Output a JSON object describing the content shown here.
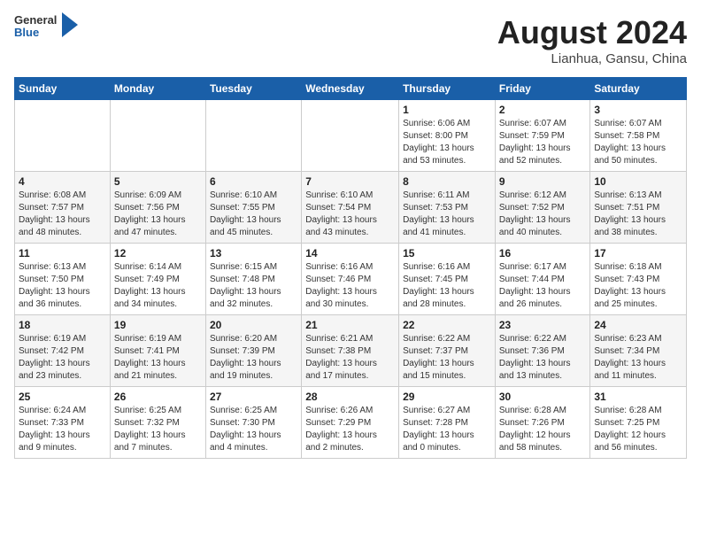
{
  "header": {
    "logo_general": "General",
    "logo_blue": "Blue",
    "month_title": "August 2024",
    "location": "Lianhua, Gansu, China"
  },
  "weekdays": [
    "Sunday",
    "Monday",
    "Tuesday",
    "Wednesday",
    "Thursday",
    "Friday",
    "Saturday"
  ],
  "weeks": [
    [
      {
        "day": "",
        "info": ""
      },
      {
        "day": "",
        "info": ""
      },
      {
        "day": "",
        "info": ""
      },
      {
        "day": "",
        "info": ""
      },
      {
        "day": "1",
        "info": "Sunrise: 6:06 AM\nSunset: 8:00 PM\nDaylight: 13 hours\nand 53 minutes."
      },
      {
        "day": "2",
        "info": "Sunrise: 6:07 AM\nSunset: 7:59 PM\nDaylight: 13 hours\nand 52 minutes."
      },
      {
        "day": "3",
        "info": "Sunrise: 6:07 AM\nSunset: 7:58 PM\nDaylight: 13 hours\nand 50 minutes."
      }
    ],
    [
      {
        "day": "4",
        "info": "Sunrise: 6:08 AM\nSunset: 7:57 PM\nDaylight: 13 hours\nand 48 minutes."
      },
      {
        "day": "5",
        "info": "Sunrise: 6:09 AM\nSunset: 7:56 PM\nDaylight: 13 hours\nand 47 minutes."
      },
      {
        "day": "6",
        "info": "Sunrise: 6:10 AM\nSunset: 7:55 PM\nDaylight: 13 hours\nand 45 minutes."
      },
      {
        "day": "7",
        "info": "Sunrise: 6:10 AM\nSunset: 7:54 PM\nDaylight: 13 hours\nand 43 minutes."
      },
      {
        "day": "8",
        "info": "Sunrise: 6:11 AM\nSunset: 7:53 PM\nDaylight: 13 hours\nand 41 minutes."
      },
      {
        "day": "9",
        "info": "Sunrise: 6:12 AM\nSunset: 7:52 PM\nDaylight: 13 hours\nand 40 minutes."
      },
      {
        "day": "10",
        "info": "Sunrise: 6:13 AM\nSunset: 7:51 PM\nDaylight: 13 hours\nand 38 minutes."
      }
    ],
    [
      {
        "day": "11",
        "info": "Sunrise: 6:13 AM\nSunset: 7:50 PM\nDaylight: 13 hours\nand 36 minutes."
      },
      {
        "day": "12",
        "info": "Sunrise: 6:14 AM\nSunset: 7:49 PM\nDaylight: 13 hours\nand 34 minutes."
      },
      {
        "day": "13",
        "info": "Sunrise: 6:15 AM\nSunset: 7:48 PM\nDaylight: 13 hours\nand 32 minutes."
      },
      {
        "day": "14",
        "info": "Sunrise: 6:16 AM\nSunset: 7:46 PM\nDaylight: 13 hours\nand 30 minutes."
      },
      {
        "day": "15",
        "info": "Sunrise: 6:16 AM\nSunset: 7:45 PM\nDaylight: 13 hours\nand 28 minutes."
      },
      {
        "day": "16",
        "info": "Sunrise: 6:17 AM\nSunset: 7:44 PM\nDaylight: 13 hours\nand 26 minutes."
      },
      {
        "day": "17",
        "info": "Sunrise: 6:18 AM\nSunset: 7:43 PM\nDaylight: 13 hours\nand 25 minutes."
      }
    ],
    [
      {
        "day": "18",
        "info": "Sunrise: 6:19 AM\nSunset: 7:42 PM\nDaylight: 13 hours\nand 23 minutes."
      },
      {
        "day": "19",
        "info": "Sunrise: 6:19 AM\nSunset: 7:41 PM\nDaylight: 13 hours\nand 21 minutes."
      },
      {
        "day": "20",
        "info": "Sunrise: 6:20 AM\nSunset: 7:39 PM\nDaylight: 13 hours\nand 19 minutes."
      },
      {
        "day": "21",
        "info": "Sunrise: 6:21 AM\nSunset: 7:38 PM\nDaylight: 13 hours\nand 17 minutes."
      },
      {
        "day": "22",
        "info": "Sunrise: 6:22 AM\nSunset: 7:37 PM\nDaylight: 13 hours\nand 15 minutes."
      },
      {
        "day": "23",
        "info": "Sunrise: 6:22 AM\nSunset: 7:36 PM\nDaylight: 13 hours\nand 13 minutes."
      },
      {
        "day": "24",
        "info": "Sunrise: 6:23 AM\nSunset: 7:34 PM\nDaylight: 13 hours\nand 11 minutes."
      }
    ],
    [
      {
        "day": "25",
        "info": "Sunrise: 6:24 AM\nSunset: 7:33 PM\nDaylight: 13 hours\nand 9 minutes."
      },
      {
        "day": "26",
        "info": "Sunrise: 6:25 AM\nSunset: 7:32 PM\nDaylight: 13 hours\nand 7 minutes."
      },
      {
        "day": "27",
        "info": "Sunrise: 6:25 AM\nSunset: 7:30 PM\nDaylight: 13 hours\nand 4 minutes."
      },
      {
        "day": "28",
        "info": "Sunrise: 6:26 AM\nSunset: 7:29 PM\nDaylight: 13 hours\nand 2 minutes."
      },
      {
        "day": "29",
        "info": "Sunrise: 6:27 AM\nSunset: 7:28 PM\nDaylight: 13 hours\nand 0 minutes."
      },
      {
        "day": "30",
        "info": "Sunrise: 6:28 AM\nSunset: 7:26 PM\nDaylight: 12 hours\nand 58 minutes."
      },
      {
        "day": "31",
        "info": "Sunrise: 6:28 AM\nSunset: 7:25 PM\nDaylight: 12 hours\nand 56 minutes."
      }
    ]
  ]
}
